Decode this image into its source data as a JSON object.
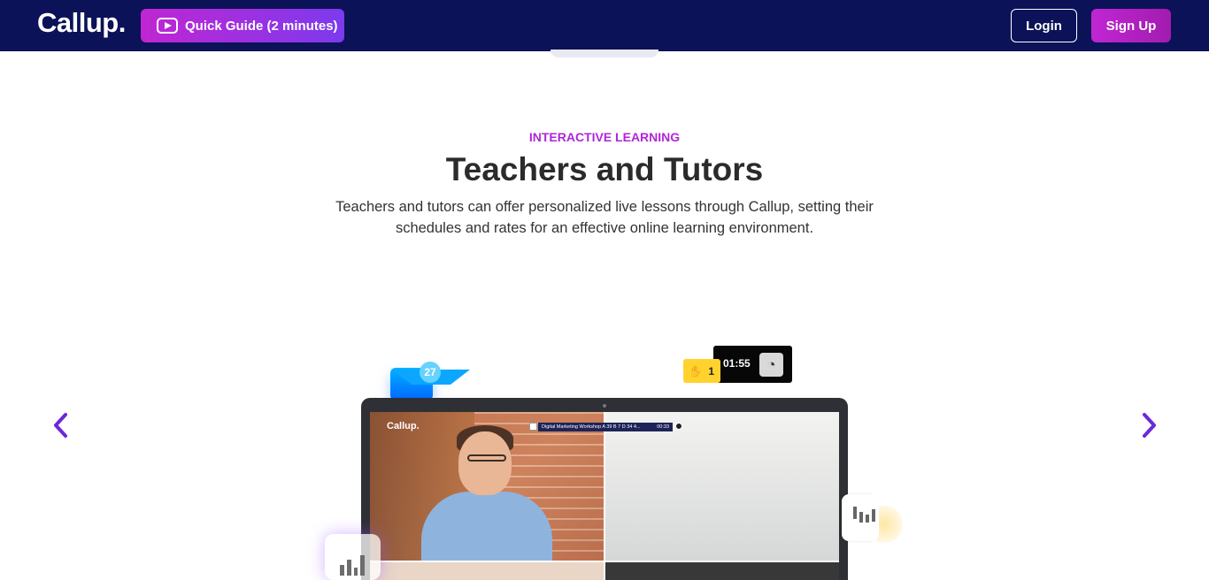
{
  "header": {
    "logo": "Callup.",
    "quick_guide_label": "Quick Guide (2 minutes)",
    "login_label": "Login",
    "signup_label": "Sign Up"
  },
  "section": {
    "eyebrow": "INTERACTIVE LEARNING",
    "title": "Teachers and Tutors",
    "description": "Teachers and tutors can offer personalized live lessons through Callup, setting their schedules and rates for an effective online learning environment."
  },
  "carousel": {
    "previous_icon": "chevron-left",
    "next_icon": "chevron-right"
  },
  "preview": {
    "screen_logo": "Callup.",
    "meeting_title": "Digital Marketing Workshop A 39 B 7 D 34 4...",
    "meeting_time": "00:33",
    "message_count": "27",
    "timer": "01:55",
    "raised_hands": "1"
  },
  "colors": {
    "nav_background": "#0b1257",
    "accent": "#b026d9",
    "button_gradient_start": "#c026d3",
    "button_gradient_end": "#7c3aed",
    "heading": "#2b2b2b"
  },
  "icons": {
    "quick_guide": "play-video-icon",
    "messages": "mail-icon",
    "timer_speed": "speedometer-icon",
    "raised_hand": "hand-icon",
    "statistics": "bar-chart-icon",
    "trading": "candlestick-chart-icon"
  }
}
